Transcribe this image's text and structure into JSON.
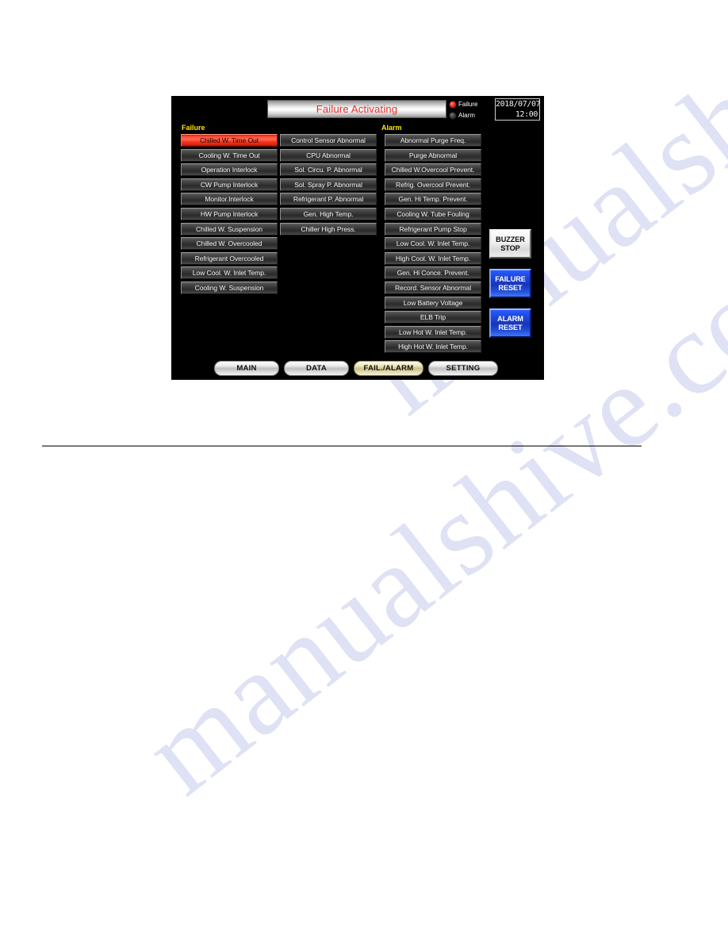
{
  "watermark": {
    "text": "manualshive.com"
  },
  "panel": {
    "header": {
      "title": "Failure Activating",
      "lamps": [
        {
          "label": "Failure",
          "state": "on",
          "color": "#ee2b20"
        },
        {
          "label": "Alarm",
          "state": "off",
          "color": "#3a3a3a"
        }
      ],
      "clock": {
        "date": "2018/07/07",
        "time": "12:00"
      }
    },
    "sections": {
      "failure_label": "Failure",
      "alarm_label": "Alarm"
    },
    "failure_column_1": [
      {
        "label": "Chilled W. Time Out",
        "active": true
      },
      {
        "label": "Cooling W. Time Out",
        "active": false
      },
      {
        "label": "Operation Interlock",
        "active": false
      },
      {
        "label": "CW Pump Interlock",
        "active": false
      },
      {
        "label": "Monitor.Interlock",
        "active": false
      },
      {
        "label": "HW Pump Interlock",
        "active": false
      },
      {
        "label": "Chilled W. Suspension",
        "active": false
      },
      {
        "label": "Chilled W. Overcooled",
        "active": false
      },
      {
        "label": "Refrigerant Overcooled",
        "active": false
      },
      {
        "label": "Low Cool. W. Inlet Temp.",
        "active": false
      },
      {
        "label": "Cooling W. Suspension",
        "active": false
      }
    ],
    "failure_column_2": [
      {
        "label": "Control Sensor Abnormal",
        "active": false
      },
      {
        "label": "CPU Abnormal",
        "active": false
      },
      {
        "label": "Sol. Circu. P. Abnormal",
        "active": false
      },
      {
        "label": "Sol. Spray P. Abnormal",
        "active": false
      },
      {
        "label": "Refrigerant P. Abnormal",
        "active": false
      },
      {
        "label": "Gen. High Temp.",
        "active": false
      },
      {
        "label": "Chiller High Press.",
        "active": false
      }
    ],
    "alarm_column": [
      {
        "label": "Abnormal Purge Freq.",
        "active": false
      },
      {
        "label": "Purge Abnormal",
        "active": false
      },
      {
        "label": "Chilled W.Overcool Prevent.",
        "active": false
      },
      {
        "label": "Refrig. Overcool Prevent.",
        "active": false
      },
      {
        "label": "Gen. Hi Temp. Prevent.",
        "active": false
      },
      {
        "label": "Cooling W. Tube Fouling",
        "active": false
      },
      {
        "label": "Refrigerant Pump Stop",
        "active": false
      },
      {
        "label": "Low Cool. W. Inlet Temp.",
        "active": false
      },
      {
        "label": "High Cool. W. Inlet Temp.",
        "active": false
      },
      {
        "label": "Gen. Hi Conce. Prevent.",
        "active": false
      },
      {
        "label": "Record. Sensor Abnormal",
        "active": false
      },
      {
        "label": "Low Battery Voltage",
        "active": false
      },
      {
        "label": "ELB Trip",
        "active": false
      },
      {
        "label": "Low Hot W. Inlet Temp.",
        "active": false
      },
      {
        "label": "High Hot W. Inlet Temp.",
        "active": false
      }
    ],
    "actions": [
      {
        "line1": "BUZZER",
        "line2": "STOP",
        "style": "silver"
      },
      {
        "line1": "FAILURE",
        "line2": "RESET",
        "style": "blue"
      },
      {
        "line1": "ALARM",
        "line2": "RESET",
        "style": "blue"
      }
    ],
    "tabs": [
      {
        "label": "MAIN",
        "active": false
      },
      {
        "label": "DATA",
        "active": false
      },
      {
        "label": "FAIL./ALARM",
        "active": true
      },
      {
        "label": "SETTING",
        "active": false
      }
    ]
  }
}
